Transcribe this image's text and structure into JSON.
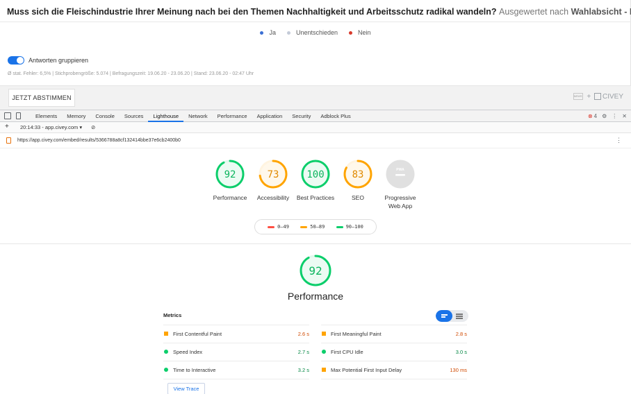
{
  "survey": {
    "question": "Muss sich die Fleischindustrie Ihrer Meinung nach bei den Themen Nachhaltigkeit und Arbeitsschutz radikal wandeln?",
    "grouped_prefix": "Ausgewertet nach",
    "grouped_by": "Wahlabsicht - Bund",
    "legend": [
      {
        "label": "Ja",
        "color": "#3b6fd4"
      },
      {
        "label": "Unentschieden",
        "color": "#c4cbd8"
      },
      {
        "label": "Nein",
        "color": "#d83a2c"
      }
    ],
    "toggle_label": "Antworten gruppieren",
    "stats": "Ø stat. Fehler: 6,5% | Stichprobengröße: 5.074 | Befragungszeit: 19.06.20 - 23.06.20 | Stand: 23.06.20 - 02:47 Uhr",
    "vote_button": "JETZT ABSTIMMEN",
    "brand_plus": "+",
    "brand_name": "CIVEY",
    "badge_text": "NEWS"
  },
  "devtools": {
    "tabs": [
      "Elements",
      "Memory",
      "Console",
      "Sources",
      "Lighthouse",
      "Network",
      "Performance",
      "Application",
      "Security",
      "Adblock Plus"
    ],
    "active_tab": "Lighthouse",
    "error_count": "4",
    "report_select": "20:14:33 - app.civey.com ▾",
    "plus": "+",
    "url": "https://app.civey.com/embed/results/5366788a8cf132414bbe37e6cb2400b0"
  },
  "gauges": [
    {
      "label": "Performance",
      "score": "92",
      "color": "#0cce6b",
      "fraction": 0.92
    },
    {
      "label": "Accessibility",
      "score": "73",
      "color": "#ffa400",
      "fraction": 0.73
    },
    {
      "label": "Best Practices",
      "score": "100",
      "color": "#0cce6b",
      "fraction": 1.0
    },
    {
      "label": "SEO",
      "score": "83",
      "color": "#ffa400",
      "fraction": 0.83
    },
    {
      "label": "Progressive Web App",
      "score": "",
      "color": "#bdbdbd",
      "fraction": 0,
      "badge": "PWA"
    }
  ],
  "scale": [
    {
      "range": "0–49",
      "color": "#ff4e42"
    },
    {
      "range": "50–89",
      "color": "#ffa400"
    },
    {
      "range": "90–100",
      "color": "#0cce6b"
    }
  ],
  "performance": {
    "score": "92",
    "fraction": 0.92,
    "title": "Performance",
    "metrics_heading": "Metrics",
    "metrics_left": [
      {
        "name": "First Contentful Paint",
        "value": "2.6 s",
        "status": "average"
      },
      {
        "name": "Speed Index",
        "value": "2.7 s",
        "status": "pass"
      },
      {
        "name": "Time to Interactive",
        "value": "3.2 s",
        "status": "pass"
      }
    ],
    "metrics_right": [
      {
        "name": "First Meaningful Paint",
        "value": "2.8 s",
        "status": "average"
      },
      {
        "name": "First CPU Idle",
        "value": "3.0 s",
        "status": "pass"
      },
      {
        "name": "Max Potential First Input Delay",
        "value": "130 ms",
        "status": "average"
      }
    ],
    "status_colors": {
      "pass": "#0cce6b",
      "average": "#ffa400",
      "pass_text": "#018642",
      "average_text": "#d04900"
    },
    "view_trace": "View Trace"
  }
}
